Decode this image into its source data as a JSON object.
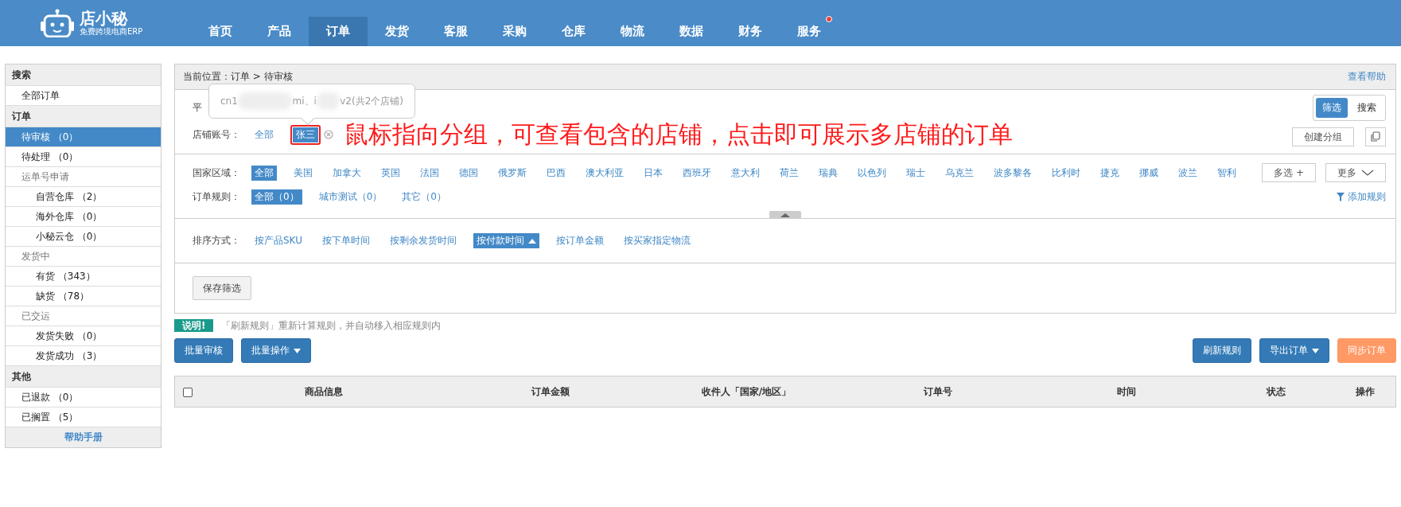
{
  "logo": {
    "name": "店小秘",
    "tagline": "免费跨境电商ERP"
  },
  "nav": [
    {
      "label": "首页",
      "selected": false,
      "badge": false
    },
    {
      "label": "产品",
      "selected": false,
      "badge": false
    },
    {
      "label": "订单",
      "selected": true,
      "badge": false
    },
    {
      "label": "发货",
      "selected": false,
      "badge": false
    },
    {
      "label": "客服",
      "selected": false,
      "badge": false
    },
    {
      "label": "采购",
      "selected": false,
      "badge": false
    },
    {
      "label": "仓库",
      "selected": false,
      "badge": false
    },
    {
      "label": "物流",
      "selected": false,
      "badge": false
    },
    {
      "label": "数据",
      "selected": false,
      "badge": false
    },
    {
      "label": "财务",
      "selected": false,
      "badge": false
    },
    {
      "label": "服务",
      "selected": false,
      "badge": true
    }
  ],
  "sidebar": {
    "groups": [
      {
        "title": "搜索",
        "items": [
          {
            "label": "全部订单",
            "selected": false
          }
        ]
      },
      {
        "title": "订单",
        "items": [
          {
            "label": "待审核 （0）",
            "selected": true
          },
          {
            "label": "待处理 （0）",
            "selected": false
          },
          {
            "label": "运单号申请",
            "selected": false,
            "children": [
              {
                "label": "自营仓库 （2）",
                "selected": false
              },
              {
                "label": "海外仓库 （0）",
                "selected": false
              },
              {
                "label": "小秘云仓 （0）",
                "selected": false
              }
            ]
          },
          {
            "label": "发货中",
            "selected": false,
            "children": [
              {
                "label": "有货 （343）",
                "selected": false
              },
              {
                "label": "缺货 （78）",
                "selected": false
              }
            ]
          },
          {
            "label": "已交运",
            "selected": false,
            "children": [
              {
                "label": "发货失败 （0）",
                "selected": false
              },
              {
                "label": "发货成功 （3）",
                "selected": false
              }
            ]
          }
        ]
      },
      {
        "title": "其他",
        "items": [
          {
            "label": "已退款 （0）",
            "selected": false
          },
          {
            "label": "已搁置 （5）",
            "selected": false
          }
        ]
      }
    ],
    "footer": "帮助手册"
  },
  "breadcrumb": {
    "label": "当前位置：",
    "path": "订单 > 待审核",
    "help": "查看帮助"
  },
  "view_toggle": [
    {
      "label": "筛选",
      "selected": true
    },
    {
      "label": "搜索",
      "selected": false
    }
  ],
  "platform_row": {
    "label": "平"
  },
  "tooltip": {
    "parts": [
      "cn1",
      "mi、i",
      "v2(共2个店铺)"
    ]
  },
  "shop_row": {
    "label": "店铺账号：",
    "options": [
      {
        "label": "全部",
        "selected": false
      },
      {
        "label": "张三",
        "selected": true
      }
    ]
  },
  "annotation": "鼠标指向分组，可查看包含的店铺，点击即可展示多店铺的订单",
  "create_group": "创建分组",
  "country_row": {
    "label": "国家区域：",
    "options": [
      {
        "label": "全部",
        "selected": true
      },
      {
        "label": "美国",
        "selected": false
      },
      {
        "label": "加拿大",
        "selected": false
      },
      {
        "label": "英国",
        "selected": false
      },
      {
        "label": "法国",
        "selected": false
      },
      {
        "label": "德国",
        "selected": false
      },
      {
        "label": "俄罗斯",
        "selected": false
      },
      {
        "label": "巴西",
        "selected": false
      },
      {
        "label": "澳大利亚",
        "selected": false
      },
      {
        "label": "日本",
        "selected": false
      },
      {
        "label": "西班牙",
        "selected": false
      },
      {
        "label": "意大利",
        "selected": false
      },
      {
        "label": "荷兰",
        "selected": false
      },
      {
        "label": "瑞典",
        "selected": false
      },
      {
        "label": "以色列",
        "selected": false
      },
      {
        "label": "瑞士",
        "selected": false
      },
      {
        "label": "乌克兰",
        "selected": false
      },
      {
        "label": "波多黎各",
        "selected": false
      },
      {
        "label": "比利时",
        "selected": false
      },
      {
        "label": "捷克",
        "selected": false
      },
      {
        "label": "挪威",
        "selected": false
      },
      {
        "label": "波兰",
        "selected": false
      },
      {
        "label": "智利",
        "selected": false
      }
    ],
    "multi": "多选 +",
    "more": "更多"
  },
  "rule_row": {
    "label": "订单规则：",
    "options": [
      {
        "label": "全部（0）",
        "selected": true
      },
      {
        "label": "城市测试（0）",
        "selected": false
      },
      {
        "label": "其它（0）",
        "selected": false
      }
    ],
    "add": "添加规则"
  },
  "sort_row": {
    "label": "排序方式：",
    "options": [
      {
        "label": "按产品SKU",
        "selected": false
      },
      {
        "label": "按下单时间",
        "selected": false
      },
      {
        "label": "按剩余发货时间",
        "selected": false
      },
      {
        "label": "按付款时间",
        "selected": true
      },
      {
        "label": "按订单金额",
        "selected": false
      },
      {
        "label": "按买家指定物流",
        "selected": false
      }
    ]
  },
  "save_filter": "保存筛选",
  "notice": {
    "badge": "说明!",
    "text": "「刷新规则」重新计算规则，并自动移入相应规则内"
  },
  "actions_left": [
    {
      "label": "批量审核",
      "kind": "primary",
      "dropdown": false
    },
    {
      "label": "批量操作",
      "kind": "primary",
      "dropdown": true
    }
  ],
  "actions_right": [
    {
      "label": "刷新规则",
      "kind": "primary",
      "dropdown": false
    },
    {
      "label": "导出订单",
      "kind": "primary",
      "dropdown": true
    },
    {
      "label": "同步订单",
      "kind": "warning",
      "dropdown": false
    }
  ],
  "table": {
    "select_all_checked": false,
    "columns": [
      "商品信息",
      "订单金额",
      "收件人「国家/地区」",
      "订单号",
      "时间",
      "状态",
      "操作"
    ]
  }
}
